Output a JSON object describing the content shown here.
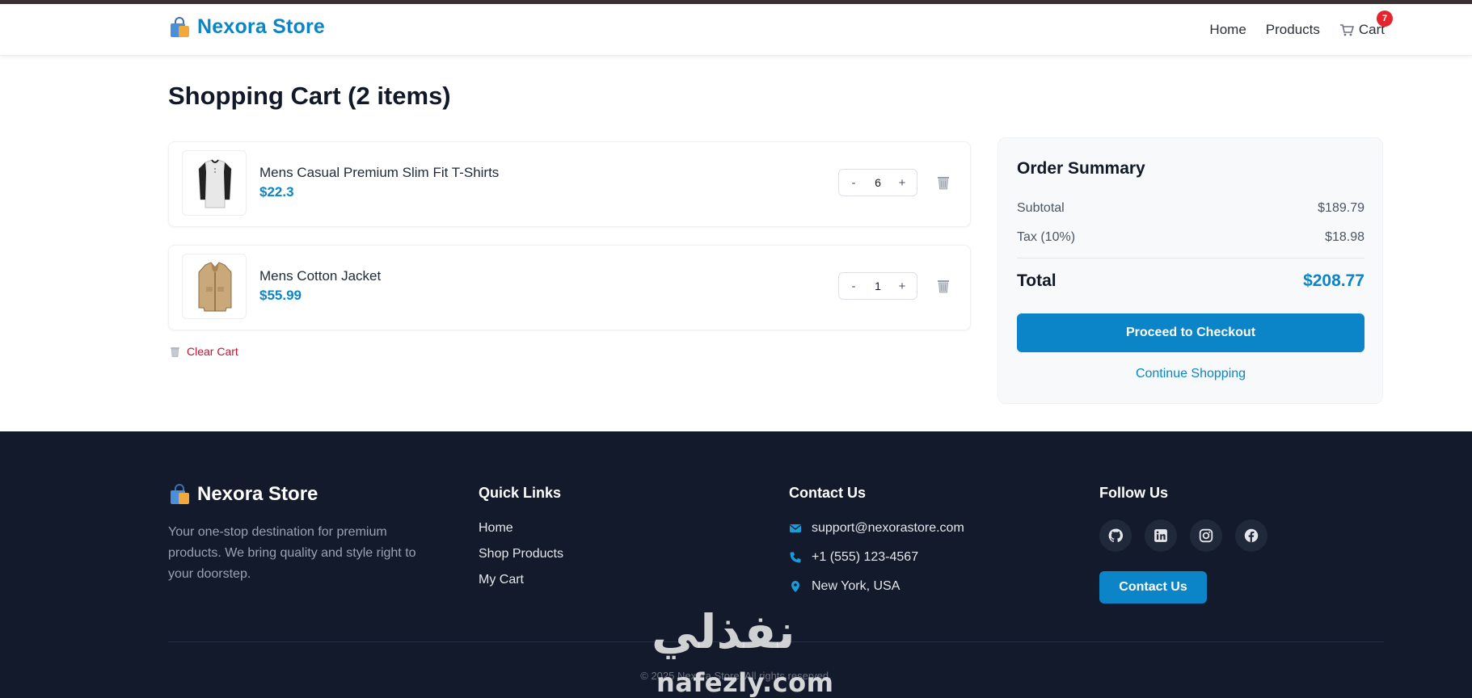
{
  "header": {
    "brand": "Nexora Store",
    "nav": {
      "home": "Home",
      "products": "Products",
      "cart": "Cart",
      "cart_count": "7"
    }
  },
  "page": {
    "title": "Shopping Cart (2 items)"
  },
  "cart": {
    "items": [
      {
        "name": "Mens Casual Premium Slim Fit T-Shirts",
        "price": "$22.3",
        "qty": "6",
        "minus": "-",
        "plus": "+"
      },
      {
        "name": "Mens Cotton Jacket",
        "price": "$55.99",
        "qty": "1",
        "minus": "-",
        "plus": "+"
      }
    ],
    "clear_label": "Clear Cart"
  },
  "summary": {
    "title": "Order Summary",
    "subtotal_label": "Subtotal",
    "subtotal_value": "$189.79",
    "tax_label": "Tax (10%)",
    "tax_value": "$18.98",
    "total_label": "Total",
    "total_value": "$208.77",
    "checkout_label": "Proceed to Checkout",
    "continue_label": "Continue Shopping"
  },
  "footer": {
    "brand": "Nexora Store",
    "about": "Your one-stop destination for premium products. We bring quality and style right to your doorstep.",
    "quick_links_title": "Quick Links",
    "quick_links": [
      "Home",
      "Shop Products",
      "My Cart"
    ],
    "contact_title": "Contact Us",
    "email": "support@nexorastore.com",
    "phone": "+1 (555) 123-4567",
    "location": "New York, USA",
    "follow_title": "Follow Us",
    "socials": [
      "github-icon",
      "linkedin-icon",
      "instagram-icon",
      "facebook-icon"
    ],
    "contact_button": "Contact Us",
    "copyright": "© 2025 Nexora Store. All rights reserved."
  },
  "watermark": {
    "arabic": "نفذلي",
    "latin": "nafezly.com"
  },
  "colors": {
    "accent": "#0b85c7",
    "danger": "#c8102e",
    "badge": "#e5252d",
    "footer_bg": "#121a2b"
  }
}
